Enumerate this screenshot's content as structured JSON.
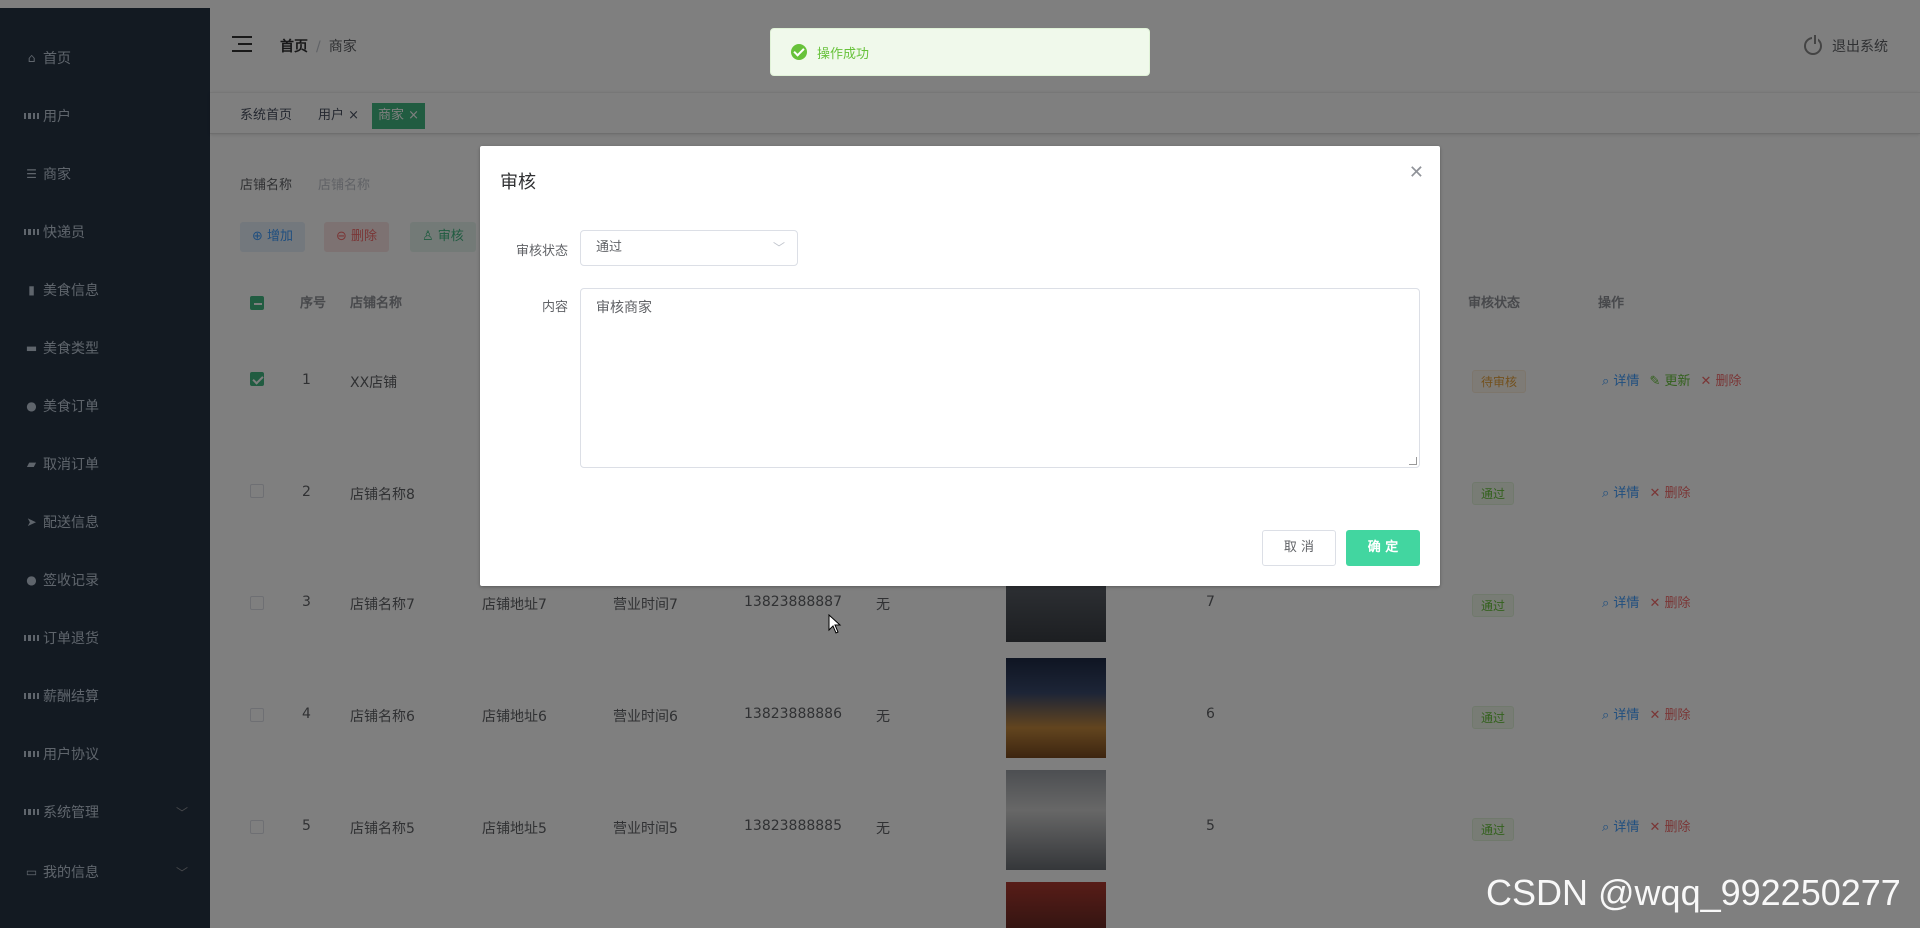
{
  "sidebar": {
    "items": [
      {
        "label": "首页",
        "icon": "home-icon"
      },
      {
        "label": "用户",
        "icon": "grid-icon"
      },
      {
        "label": "商家",
        "icon": "sliders-icon"
      },
      {
        "label": "快递员",
        "icon": "grid-icon"
      },
      {
        "label": "美食信息",
        "icon": "bar-chart-icon"
      },
      {
        "label": "美食类型",
        "icon": "briefcase-icon"
      },
      {
        "label": "美食订单",
        "icon": "user-icon"
      },
      {
        "label": "取消订单",
        "icon": "truck-icon"
      },
      {
        "label": "配送信息",
        "icon": "send-icon"
      },
      {
        "label": "签收记录",
        "icon": "location-icon"
      },
      {
        "label": "订单退货",
        "icon": "grid-icon"
      },
      {
        "label": "薪酬结算",
        "icon": "grid-icon"
      },
      {
        "label": "用户协议",
        "icon": "grid-icon"
      },
      {
        "label": "系统管理",
        "icon": "grid-icon"
      },
      {
        "label": "我的信息",
        "icon": "window-icon"
      }
    ]
  },
  "header": {
    "breadcrumb_home": "首页",
    "breadcrumb_sep": "/",
    "breadcrumb_current": "商家",
    "logout": "退出系统"
  },
  "tags": {
    "home": "系统首页",
    "user": "用户 ×",
    "merchant": "商家 ×"
  },
  "search": {
    "label": "店铺名称",
    "placeholder": "店铺名称"
  },
  "toolbar": {
    "add": "增加",
    "delete": "删除",
    "audit": "审核"
  },
  "table": {
    "headers": {
      "index": "序号",
      "name": "店铺名称",
      "status": "审核状态",
      "action": "操作"
    },
    "rows": [
      {
        "index": "1",
        "name": "XX店铺",
        "address": "",
        "hours": "",
        "phone": "",
        "note": "",
        "score": "",
        "status": "待审核",
        "actions": [
          "详情",
          "更新",
          "删除"
        ]
      },
      {
        "index": "2",
        "name": "店铺名称8",
        "address": "",
        "hours": "",
        "phone": "",
        "note": "",
        "score": "",
        "status": "通过",
        "actions": [
          "详情",
          "删除"
        ]
      },
      {
        "index": "3",
        "name": "店铺名称7",
        "address": "店铺地址7",
        "hours": "营业时间7",
        "phone": "13823888887",
        "note": "无",
        "score": "7",
        "status": "通过",
        "actions": [
          "详情",
          "删除"
        ]
      },
      {
        "index": "4",
        "name": "店铺名称6",
        "address": "店铺地址6",
        "hours": "营业时间6",
        "phone": "13823888886",
        "note": "无",
        "score": "6",
        "status": "通过",
        "actions": [
          "详情",
          "删除"
        ]
      },
      {
        "index": "5",
        "name": "店铺名称5",
        "address": "店铺地址5",
        "hours": "营业时间5",
        "phone": "13823888885",
        "note": "无",
        "score": "5",
        "status": "通过",
        "actions": [
          "详情",
          "删除"
        ]
      }
    ]
  },
  "toast": {
    "message": "操作成功"
  },
  "dialog": {
    "title": "审核",
    "status_label": "审核状态",
    "status_value": "通过",
    "content_label": "内容",
    "content_value": "审核商家",
    "cancel": "取 消",
    "confirm": "确 定"
  },
  "watermark": "CSDN @wqq_992250277",
  "colors": {
    "sidebar": "#263445",
    "accent": "#42b983",
    "confirm": "#42d6a0",
    "success": "#67c23a"
  }
}
